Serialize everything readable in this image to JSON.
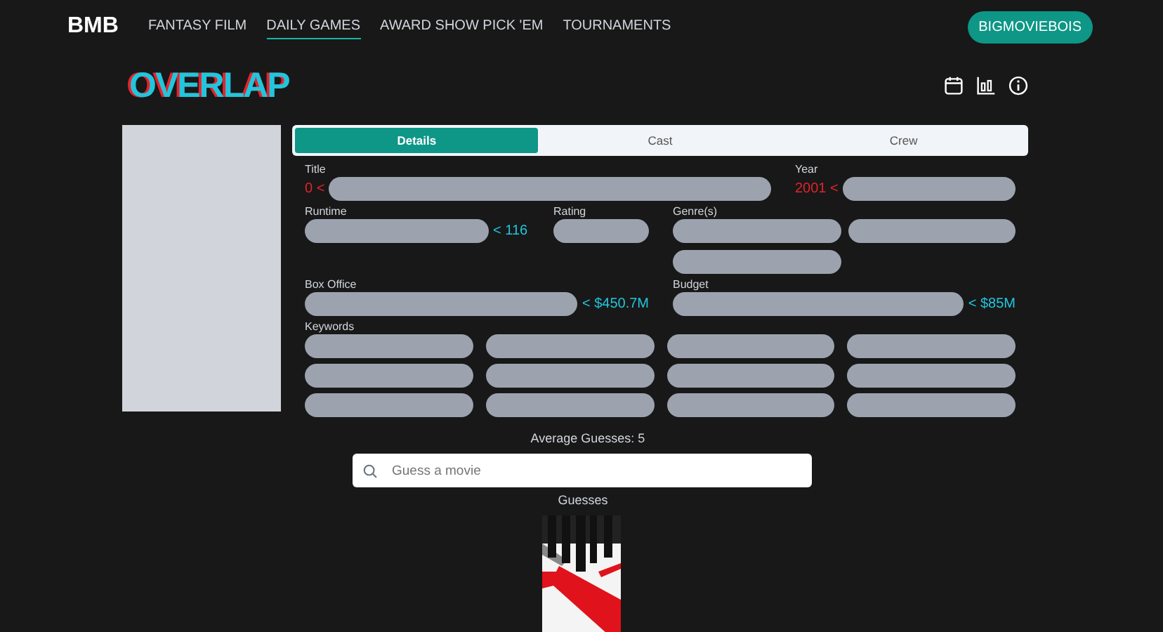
{
  "nav": {
    "brand": "BMB",
    "links": [
      {
        "label": "FANTASY FILM",
        "selected": false
      },
      {
        "label": "DAILY GAMES",
        "selected": true
      },
      {
        "label": "AWARD SHOW PICK 'EM",
        "selected": false
      },
      {
        "label": "TOURNAMENTS",
        "selected": false
      }
    ],
    "account": "BIGMOVIEBOIS"
  },
  "game": {
    "title": "OVERLAP"
  },
  "tabs": [
    {
      "label": "Details",
      "selected": true
    },
    {
      "label": "Cast",
      "selected": false
    },
    {
      "label": "Crew",
      "selected": false
    }
  ],
  "fields": [
    {
      "label": "Title",
      "hint": {
        "text": "0 <",
        "kind": "prefix",
        "color": "#e5232b"
      },
      "slots": [
        {
          "revealed": false
        }
      ]
    },
    {
      "label": "Year",
      "hint": {
        "text": "2001 <",
        "kind": "prefix",
        "color": "#e5232b"
      },
      "slots": [
        {
          "revealed": false
        }
      ]
    },
    {
      "label": "Runtime",
      "hint": {
        "text": "< 116",
        "kind": "suffix",
        "color": "#22c5dc"
      },
      "slots": [
        {
          "revealed": false
        }
      ]
    },
    {
      "label": "Rating",
      "slots": [
        {
          "revealed": false
        }
      ]
    },
    {
      "label": "Genre(s)",
      "slots": [
        {
          "revealed": false
        },
        {
          "revealed": false
        },
        {
          "revealed": false
        }
      ]
    },
    {
      "label": "Box Office",
      "hint": {
        "text": "< $450.7M",
        "kind": "suffix",
        "color": "#22c5dc"
      },
      "slots": [
        {
          "revealed": false
        }
      ]
    },
    {
      "label": "Budget",
      "hint": {
        "text": "< $85M",
        "kind": "suffix",
        "color": "#22c5dc"
      },
      "slots": [
        {
          "revealed": false
        }
      ]
    },
    {
      "label": "Keywords",
      "slots": [
        {
          "revealed": false
        },
        {
          "revealed": false
        },
        {
          "revealed": false
        },
        {
          "revealed": false
        },
        {
          "revealed": false
        },
        {
          "revealed": false
        },
        {
          "revealed": false
        },
        {
          "revealed": false
        },
        {
          "revealed": false
        },
        {
          "revealed": false
        },
        {
          "revealed": false
        },
        {
          "revealed": false
        }
      ]
    }
  ],
  "average": "Average Guesses: 5",
  "search": {
    "placeholder": "Guess a movie"
  },
  "guesses_label": "Guesses"
}
